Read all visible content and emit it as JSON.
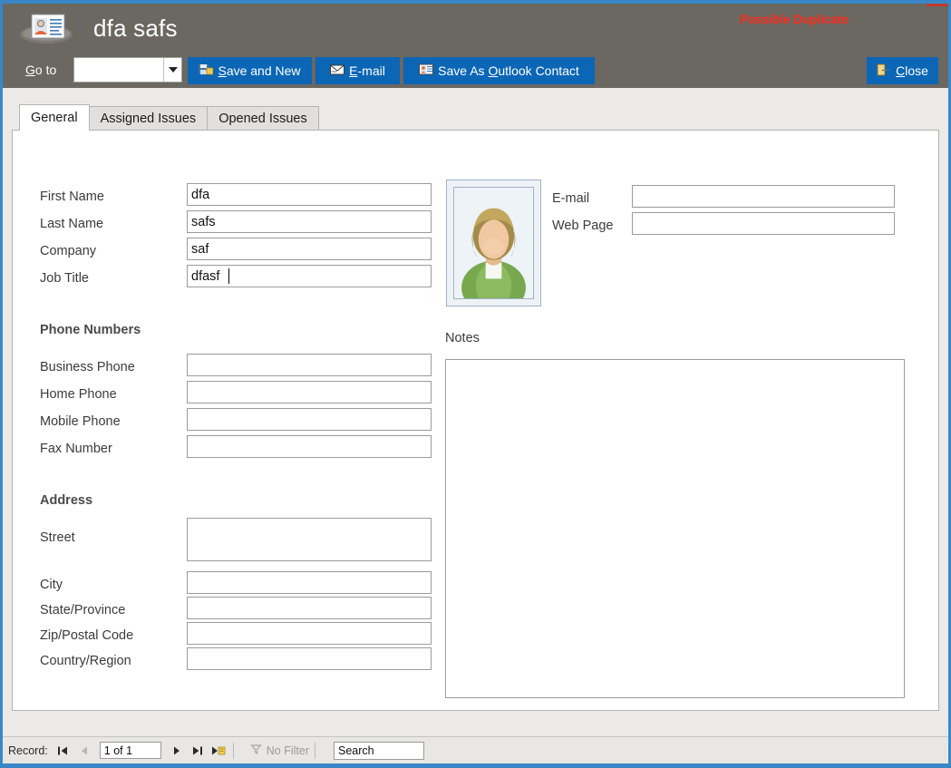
{
  "window": {
    "title": "dfa safs",
    "brand_icon": "contact-card-icon",
    "duplicate_warning": "Possible Duplicate",
    "accent_blue": "#3a87c8",
    "header_bg": "#6b6761",
    "button_blue": "#0b66b5",
    "warning_color": "#ff2a18"
  },
  "toolbar": {
    "goto_label_prefix": "G",
    "goto_label_rest": "o to",
    "goto_value": "",
    "goto_dropdown_icon": "chevron-down-icon",
    "buttons": [
      {
        "id": "save-and-new",
        "icon": "save-new-icon",
        "pre": "",
        "accel": "S",
        "post": "ave and New"
      },
      {
        "id": "email",
        "icon": "envelope-icon",
        "pre": "",
        "accel": "E",
        "post": "-mail"
      },
      {
        "id": "outlook",
        "icon": "contact-card-small-icon",
        "pre": "Save As ",
        "accel": "O",
        "post": "utlook Contact"
      },
      {
        "id": "close",
        "icon": "door-exit-icon",
        "pre": "",
        "accel": "C",
        "post": "lose"
      }
    ]
  },
  "tabs": [
    {
      "label": "General",
      "active": true
    },
    {
      "label": "Assigned Issues",
      "active": false
    },
    {
      "label": "Opened Issues",
      "active": false
    }
  ],
  "form": {
    "identity": [
      {
        "label": "First Name",
        "value": "dfa",
        "focused": false
      },
      {
        "label": "Last Name",
        "value": "safs",
        "focused": false
      },
      {
        "label": "Company",
        "value": "saf",
        "focused": false
      },
      {
        "label": "Job Title",
        "value": "dfasf",
        "focused": true
      }
    ],
    "photo_alt": "contact-photo",
    "contact": [
      {
        "label": "E-mail",
        "value": ""
      },
      {
        "label": "Web Page",
        "value": ""
      }
    ],
    "phone_section_title": "Phone Numbers",
    "phones": [
      {
        "label": "Business Phone",
        "value": ""
      },
      {
        "label": "Home Phone",
        "value": ""
      },
      {
        "label": "Mobile Phone",
        "value": ""
      },
      {
        "label": "Fax Number",
        "value": ""
      }
    ],
    "address_section_title": "Address",
    "address": [
      {
        "label": "Street",
        "value": "",
        "multiline": true
      },
      {
        "label": "City",
        "value": ""
      },
      {
        "label": "State/Province",
        "value": ""
      },
      {
        "label": "Zip/Postal Code",
        "value": ""
      },
      {
        "label": "Country/Region",
        "value": ""
      }
    ],
    "notes_label": "Notes",
    "notes_value": ""
  },
  "statusbar": {
    "record_label": "Record:",
    "first_icon": "first-record-icon",
    "prev_icon": "previous-record-icon",
    "position": "1 of 1",
    "next_icon": "next-record-icon",
    "last_icon": "last-record-icon",
    "new_icon": "new-record-icon",
    "filter_icon": "filter-icon",
    "filter_label": "No Filter",
    "search_value": "Search"
  }
}
